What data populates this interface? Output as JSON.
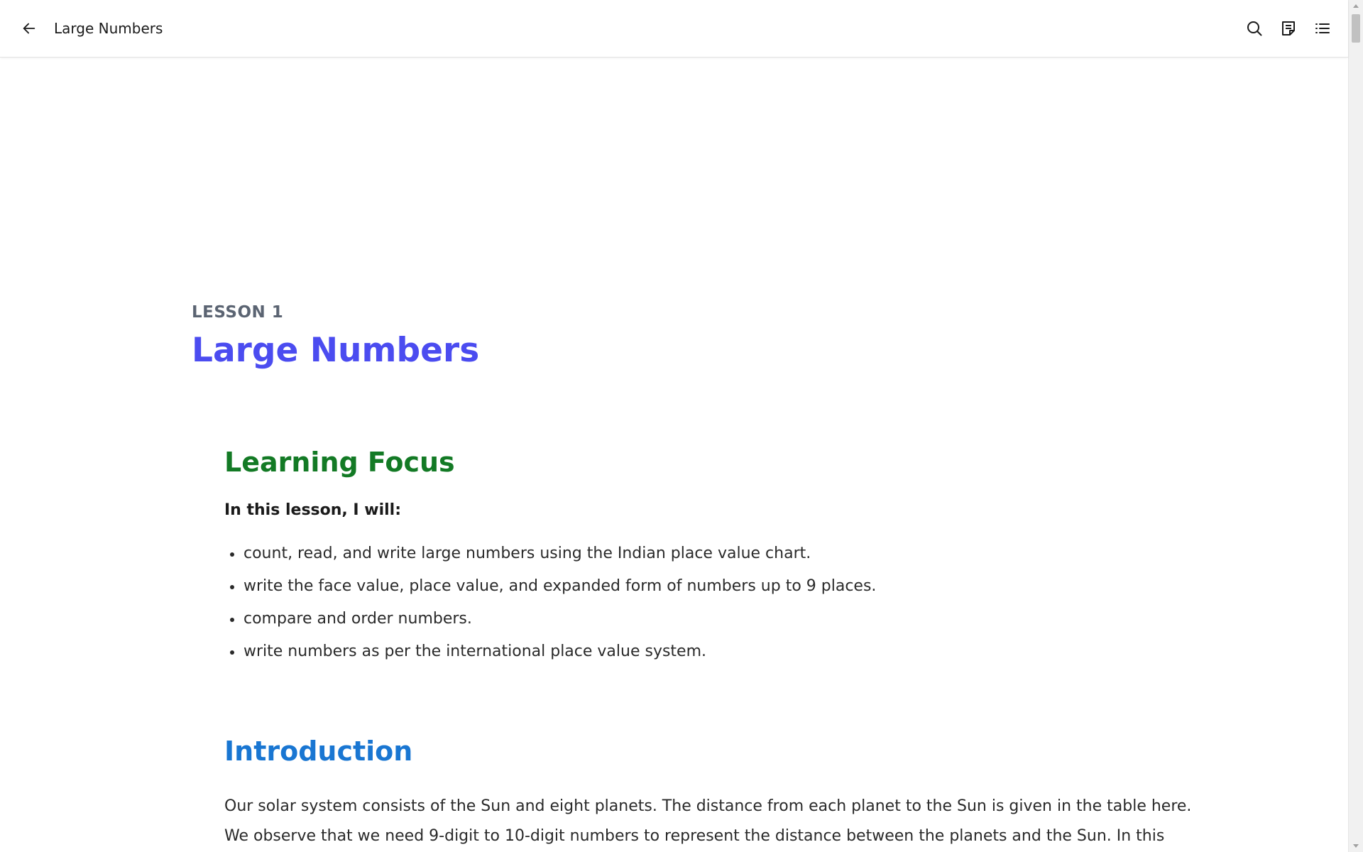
{
  "header": {
    "book_title": "Large Numbers",
    "icons": {
      "back": "arrow-left-icon",
      "search": "search-icon",
      "notes": "notes-icon",
      "toc": "list-icon"
    }
  },
  "lesson": {
    "label": "LESSON 1",
    "title": "Large Numbers"
  },
  "learning_focus": {
    "heading": "Learning Focus",
    "intro": "In this lesson, I will:",
    "items": [
      "count, read, and write large numbers using the Indian place value chart.",
      "write the face value, place value, and expanded form of numbers up to 9 places.",
      "compare and order numbers.",
      "write numbers as per the international place value system."
    ]
  },
  "introduction": {
    "heading": "Introduction",
    "lines": [
      "Our solar system consists of the Sun and eight planets. The distance from each planet to the Sun is given in the table here.",
      "We observe that we need 9-digit to 10-digit numbers to represent the distance between the planets and the Sun. In this"
    ]
  },
  "colors": {
    "lesson_label": "#5b6472",
    "lesson_title": "#4b4cf0",
    "focus_heading": "#137a25",
    "intro_heading": "#1976d2"
  }
}
